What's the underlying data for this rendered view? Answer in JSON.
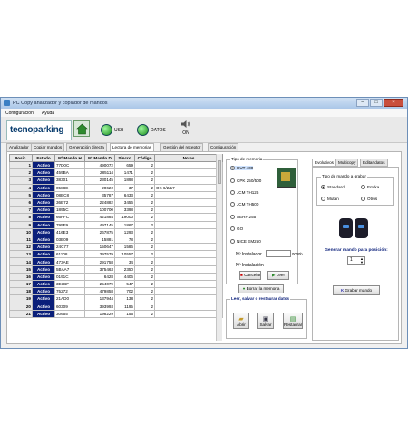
{
  "window": {
    "title": "PC Copy analizador y copiador de mandos",
    "menu": [
      "Configuración",
      "Ayuda"
    ],
    "controls": [
      "–",
      "□",
      "×"
    ]
  },
  "toolbar": {
    "logo_text": "tecnoparking",
    "usb_label": "USB",
    "datos_label": "DATOS",
    "sound_label": "ON"
  },
  "tabs": [
    {
      "label": "Analizador"
    },
    {
      "label": "Copiar mandos"
    },
    {
      "label": "Generación directa"
    },
    {
      "label": "Lectura de memorias"
    },
    {
      "label": "Gestión del receptor"
    },
    {
      "label": "Configuración"
    }
  ],
  "active_tab": "Lectura de memorias",
  "table": {
    "headers": [
      "Posic.",
      "Estado",
      "Nº Mando H",
      "Nº Mando D",
      "Sincro",
      "Código",
      "Notas"
    ],
    "rows": [
      [
        "1",
        "Activo",
        "77D0C",
        "490072",
        "659",
        "2",
        ""
      ],
      [
        "2",
        "Activo",
        "459BA",
        "285114",
        "1471",
        "2",
        ""
      ],
      [
        "3",
        "Activo",
        "38301",
        "230145",
        "1898",
        "2",
        ""
      ],
      [
        "4",
        "Activo",
        "0588E",
        "20622",
        "37",
        "2",
        "OK 6/2/17"
      ],
      [
        "5",
        "Activo",
        "08BC8",
        "35787",
        "6433",
        "2",
        ""
      ],
      [
        "6",
        "Activo",
        "36E72",
        "224882",
        "3456",
        "2",
        ""
      ],
      [
        "7",
        "Activo",
        "1895C",
        "100700",
        "3398",
        "2",
        ""
      ],
      [
        "8",
        "Activo",
        "66FFC",
        "421884",
        "19000",
        "2",
        ""
      ],
      [
        "9",
        "Activo",
        "795F9",
        "497145",
        "1867",
        "2",
        ""
      ],
      [
        "10",
        "Activo",
        "416E3",
        "267875",
        "1293",
        "2",
        ""
      ],
      [
        "11",
        "Activo",
        "03E09",
        "15881",
        "78",
        "2",
        ""
      ],
      [
        "12",
        "Activo",
        "24C77",
        "150647",
        "1586",
        "2",
        ""
      ],
      [
        "13",
        "Activo",
        "61108",
        "397579",
        "10557",
        "2",
        ""
      ],
      [
        "14",
        "Activo",
        "473AE",
        "291758",
        "34",
        "2",
        ""
      ],
      [
        "15",
        "Activo",
        "5BAA7",
        "375463",
        "2350",
        "2",
        ""
      ],
      [
        "16",
        "Activo",
        "0191C",
        "6428",
        "4406",
        "2",
        ""
      ],
      [
        "17",
        "Activo",
        "3E3BF",
        "254079",
        "547",
        "2",
        ""
      ],
      [
        "18",
        "Activo",
        "75272",
        "479858",
        "702",
        "2",
        ""
      ],
      [
        "19",
        "Activo",
        "21AD0",
        "137944",
        "138",
        "2",
        ""
      ],
      [
        "20",
        "Activo",
        "60309",
        "393993",
        "1195",
        "2",
        ""
      ],
      [
        "21",
        "Activo",
        "30655",
        "198229",
        "156",
        "2",
        ""
      ]
    ]
  },
  "memory": {
    "legend": "Tipo de memoria",
    "options": [
      "HUT 400",
      "CPK 250/500",
      "JCM TH126",
      "JCM TH500",
      "AERF 255",
      "GO",
      "NICE EM250"
    ],
    "selected": 0,
    "instalador_label": "Nº Instalador",
    "instalador_value": "0000h",
    "instalacion_label": "Nº Instalación",
    "cancelar_label": "Cancelar",
    "leer_label": "Leer",
    "borrar_label": "Borrar la memoria"
  },
  "restore": {
    "legend": "Leer, salvar o restaurar datos",
    "abrir_label": "Abrir",
    "salvar_label": "Salvar",
    "restaurar_label": "Restaurar"
  },
  "right": {
    "tabs": [
      "Evolutivos",
      "Multicopy",
      "Editar datos"
    ],
    "active": 0,
    "group_legend": "Tipo de mando a grabar",
    "options": [
      "Standard",
      "Emrka",
      "Mutan",
      "Otros"
    ],
    "selected": 0,
    "generar_label": "Generar mando para posición:",
    "position_value": "1",
    "grabar_label": "Grabar mando"
  },
  "colors": {
    "estado_bg": "#0a1f7a",
    "led_green": "#1a8c1a",
    "title_blue": "#0a1f7a"
  }
}
